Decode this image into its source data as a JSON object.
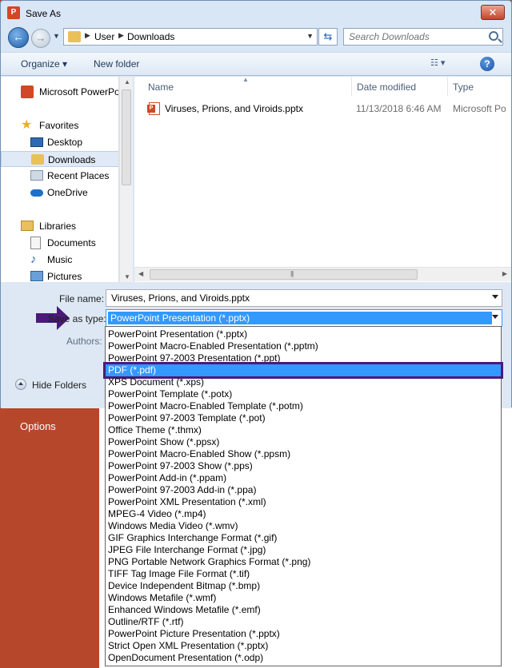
{
  "window": {
    "title": "Save As",
    "close_glyph": "✕",
    "app_icon_letter": "P"
  },
  "address": {
    "segments": [
      "User",
      "Downloads"
    ]
  },
  "search": {
    "placeholder": "Search Downloads"
  },
  "toolbar": {
    "organize": "Organize ▾",
    "new_folder": "New folder",
    "help": "?"
  },
  "sidebar": {
    "items": [
      {
        "label": "Microsoft PowerPoint",
        "icon": "powerpoint-icon",
        "sub": false,
        "selected": false
      },
      {
        "label": "Favorites",
        "icon": "star-icon",
        "sub": false,
        "selected": false
      },
      {
        "label": "Desktop",
        "icon": "desktop-icon",
        "sub": true,
        "selected": false
      },
      {
        "label": "Downloads",
        "icon": "downloads-folder-icon",
        "sub": true,
        "selected": true
      },
      {
        "label": "Recent Places",
        "icon": "recent-places-icon",
        "sub": true,
        "selected": false
      },
      {
        "label": "OneDrive",
        "icon": "cloud-icon",
        "sub": true,
        "selected": false
      },
      {
        "label": "Libraries",
        "icon": "libraries-icon",
        "sub": false,
        "selected": false
      },
      {
        "label": "Documents",
        "icon": "documents-icon",
        "sub": true,
        "selected": false
      },
      {
        "label": "Music",
        "icon": "music-icon",
        "sub": true,
        "selected": false
      },
      {
        "label": "Pictures",
        "icon": "pictures-icon",
        "sub": true,
        "selected": false
      }
    ]
  },
  "file_list": {
    "columns": [
      "Name",
      "Date modified",
      "Type"
    ],
    "rows": [
      {
        "name": "Viruses, Prions, and Viroids.pptx",
        "date": "11/13/2018 6:46 AM",
        "type": "Microsoft Po"
      }
    ]
  },
  "form": {
    "filename_label": "File name:",
    "filename_value": "Viruses, Prions, and Viroids.pptx",
    "savetype_label": "Save as type:",
    "savetype_value": "PowerPoint Presentation (*.pptx)",
    "authors_label": "Authors:",
    "hide_folders": "Hide Folders"
  },
  "backstage": {
    "options": "Options"
  },
  "save_types": {
    "highlighted_index": 3,
    "items": [
      "PowerPoint Presentation (*.pptx)",
      "PowerPoint Macro-Enabled Presentation (*.pptm)",
      "PowerPoint 97-2003 Presentation (*.ppt)",
      "PDF (*.pdf)",
      "XPS Document (*.xps)",
      "PowerPoint Template (*.potx)",
      "PowerPoint Macro-Enabled Template (*.potm)",
      "PowerPoint 97-2003 Template (*.pot)",
      "Office Theme (*.thmx)",
      "PowerPoint Show (*.ppsx)",
      "PowerPoint Macro-Enabled Show (*.ppsm)",
      "PowerPoint 97-2003 Show (*.pps)",
      "PowerPoint Add-in (*.ppam)",
      "PowerPoint 97-2003 Add-in (*.ppa)",
      "PowerPoint XML Presentation (*.xml)",
      "MPEG-4 Video (*.mp4)",
      "Windows Media Video (*.wmv)",
      "GIF Graphics Interchange Format (*.gif)",
      "JPEG File Interchange Format (*.jpg)",
      "PNG Portable Network Graphics Format (*.png)",
      "TIFF Tag Image File Format (*.tif)",
      "Device Independent Bitmap (*.bmp)",
      "Windows Metafile (*.wmf)",
      "Enhanced Windows Metafile (*.emf)",
      "Outline/RTF (*.rtf)",
      "PowerPoint Picture Presentation (*.pptx)",
      "Strict Open XML Presentation (*.pptx)",
      "OpenDocument Presentation (*.odp)"
    ]
  },
  "colors": {
    "accent": "#3399ff",
    "highlight_border": "#4b1a78",
    "arrow": "#4b1a78",
    "powerpoint": "#b7472a"
  }
}
